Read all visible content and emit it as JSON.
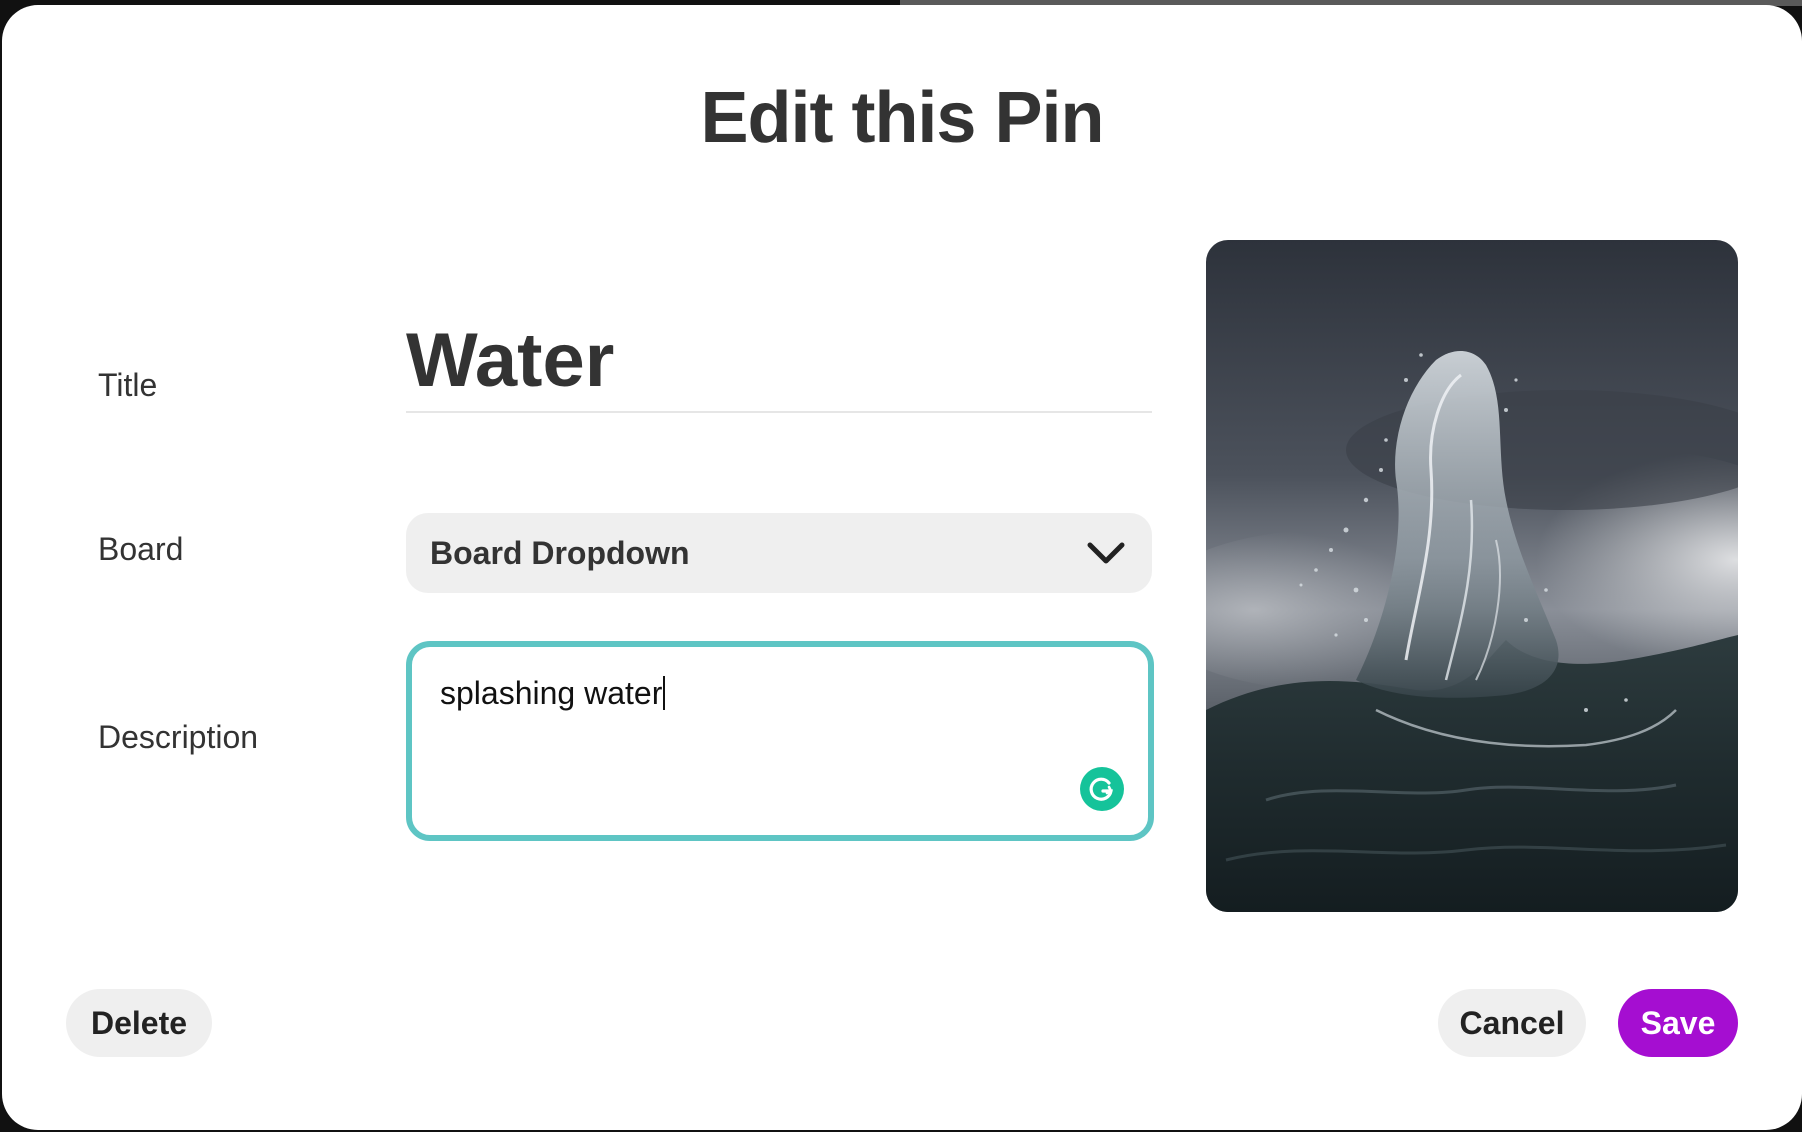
{
  "modal": {
    "title": "Edit this Pin"
  },
  "form": {
    "title_label": "Title",
    "title_value": "Water",
    "board_label": "Board",
    "board_value": "Board Dropdown",
    "description_label": "Description",
    "description_value": "splashing water"
  },
  "pin": {
    "image_subject": "splashing water wave against cloudy sky"
  },
  "actions": {
    "delete_label": "Delete",
    "cancel_label": "Cancel",
    "save_label": "Save"
  },
  "colors": {
    "accent": "#a50ed1",
    "focus_border": "#5ec5c4",
    "grammarly": "#15c39a",
    "text": "#333333",
    "button_gray": "#efefef"
  },
  "icons": {
    "dropdown": "chevron-down-icon",
    "grammarly": "grammarly-icon"
  }
}
